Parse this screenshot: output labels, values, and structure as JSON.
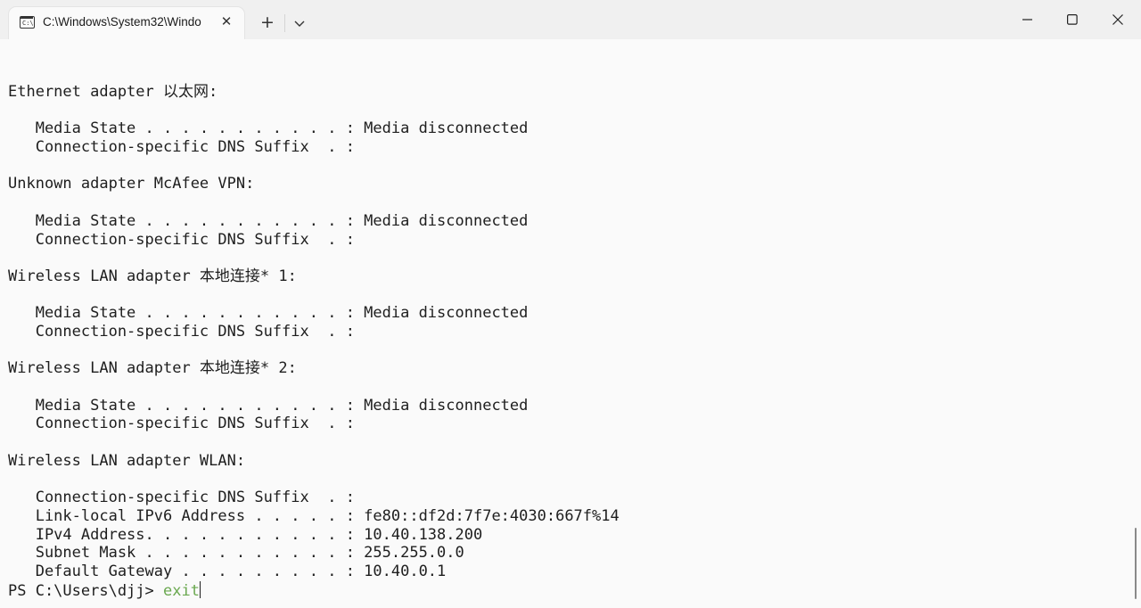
{
  "window": {
    "tab_title": "C:\\Windows\\System32\\Windo",
    "tab_icon_text": "C:\\",
    "tab_close_glyph": "✕",
    "new_tab_glyph": "+",
    "icons": {
      "tab": "terminal-icon",
      "close_tab": "close-icon",
      "new_tab": "plus-icon",
      "dropdown": "chevron-down-icon",
      "minimize": "minimize-icon",
      "maximize": "maximize-icon",
      "close": "close-icon"
    }
  },
  "terminal": {
    "lines": [
      "Ethernet adapter 以太网:",
      "",
      "   Media State . . . . . . . . . . . : Media disconnected",
      "   Connection-specific DNS Suffix  . :",
      "",
      "Unknown adapter McAfee VPN:",
      "",
      "   Media State . . . . . . . . . . . : Media disconnected",
      "   Connection-specific DNS Suffix  . :",
      "",
      "Wireless LAN adapter 本地连接* 1:",
      "",
      "   Media State . . . . . . . . . . . : Media disconnected",
      "   Connection-specific DNS Suffix  . :",
      "",
      "Wireless LAN adapter 本地连接* 2:",
      "",
      "   Media State . . . . . . . . . . . : Media disconnected",
      "   Connection-specific DNS Suffix  . :",
      "",
      "Wireless LAN adapter WLAN:",
      "",
      "   Connection-specific DNS Suffix  . :",
      "   Link-local IPv6 Address . . . . . : fe80::df2d:7f7e:4030:667f%14",
      "   IPv4 Address. . . . . . . . . . . : 10.40.138.200",
      "   Subnet Mask . . . . . . . . . . . : 255.255.0.0",
      "   Default Gateway . . . . . . . . . : 10.40.0.1"
    ],
    "prompt": "PS C:\\Users\\djj> ",
    "command": "exit"
  },
  "colors": {
    "background": "#fafafa",
    "titlebar": "#f0f0f0",
    "text": "#1e1e1e",
    "command": "#6aa84f"
  }
}
